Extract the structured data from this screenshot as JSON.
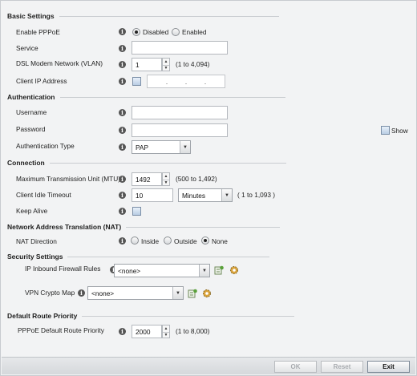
{
  "sections": {
    "basic": "Basic Settings",
    "auth": "Authentication",
    "connection": "Connection",
    "nat": "Network Address Translation (NAT)",
    "security": "Security Settings",
    "route": "Default Route Priority"
  },
  "basic": {
    "enable_pppoe_label": "Enable PPPoE",
    "enable_options": [
      "Disabled",
      "Enabled"
    ],
    "enable_selected": "Disabled",
    "service_label": "Service",
    "service_value": "",
    "vlan_label": "DSL Modem Network (VLAN)",
    "vlan_value": "1",
    "vlan_range": "(1 to 4,094)",
    "client_ip_label": "Client IP Address",
    "client_ip_enabled": false
  },
  "auth": {
    "username_label": "Username",
    "username_value": "",
    "password_label": "Password",
    "password_value": "",
    "show_label": "Show",
    "show_checked": false,
    "auth_type_label": "Authentication Type",
    "auth_type_value": "PAP"
  },
  "connection": {
    "mtu_label": "Maximum Transmission Unit (MTU)",
    "mtu_value": "1492",
    "mtu_range": "(500 to 1,492)",
    "idle_label": "Client Idle Timeout",
    "idle_value": "10",
    "idle_unit": "Minutes",
    "idle_range": "( 1 to 1,093 )",
    "keepalive_label": "Keep Alive",
    "keepalive_checked": false
  },
  "nat": {
    "direction_label": "NAT Direction",
    "options": [
      "Inside",
      "Outside",
      "None"
    ],
    "selected": "None"
  },
  "security": {
    "firewall_label": "IP Inbound Firewall Rules",
    "firewall_value": "<none>",
    "vpn_label": "VPN Crypto Map",
    "vpn_value": "<none>"
  },
  "route": {
    "priority_label": "PPPoE Default Route Priority",
    "priority_value": "2000",
    "priority_range": "(1 to 8,000)"
  },
  "footer": {
    "ok": "OK",
    "reset": "Reset",
    "exit": "Exit"
  },
  "icons": {
    "info": "info-icon",
    "add": "add-policy-icon",
    "edit": "gear-icon"
  }
}
